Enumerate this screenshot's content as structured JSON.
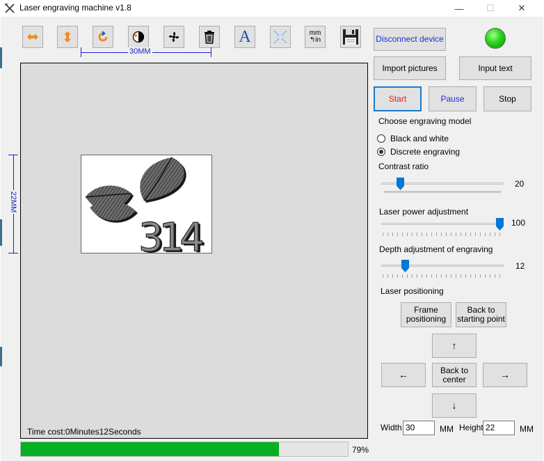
{
  "window": {
    "title": "Laser engraving machine v1.8",
    "minimize_glyph": "—",
    "maximize_glyph": "☐",
    "close_glyph": "✕"
  },
  "toolbar": {
    "text_tool_glyph": "A",
    "units_top": "mm",
    "units_bottom": "↰in",
    "width_dimension": "30MM",
    "height_dimension": "22MM"
  },
  "device": {
    "disconnect_label": "Disconnect device",
    "status_color": "#27d21a"
  },
  "actions": {
    "import_pictures": "Import pictures",
    "input_text": "Input text",
    "start": "Start",
    "pause": "Pause",
    "stop": "Stop"
  },
  "mode": {
    "heading": "Choose engraving model",
    "options": [
      "Black and white",
      "Discrete engraving"
    ],
    "selected": "Discrete engraving"
  },
  "contrast": {
    "label": "Contrast ratio",
    "value": "20",
    "fraction": 0.08
  },
  "power": {
    "label": "Laser power adjustment",
    "value": "100",
    "fraction": 1.0
  },
  "depth": {
    "label": "Depth adjustment of engraving",
    "value": "12",
    "fraction": 0.12
  },
  "positioning": {
    "heading": "Laser positioning",
    "frame": "Frame positioning",
    "back_start": "Back to starting point",
    "up": "↑",
    "down": "↓",
    "left": "←",
    "right": "→",
    "center": "Back to center"
  },
  "size": {
    "width_label": "Width",
    "width_value": "30",
    "width_unit": "MM",
    "height_label": "Height",
    "height_value": "22",
    "height_unit": "MM"
  },
  "canvas": {
    "time_cost": "Time cost:0Minutes12Seconds",
    "preview_text": "314"
  },
  "progress": {
    "percent_label": "79%",
    "fraction": 0.79
  }
}
